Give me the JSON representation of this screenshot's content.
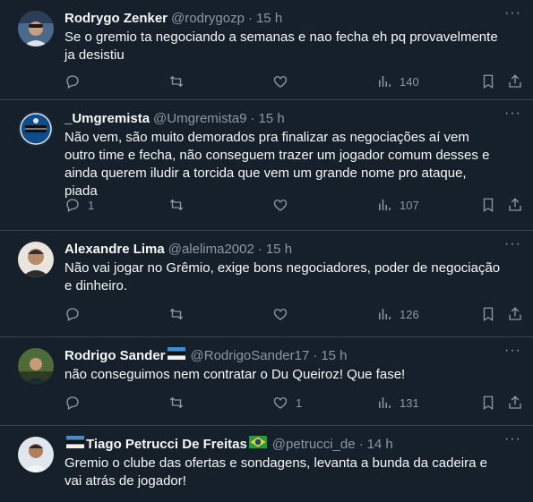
{
  "tweets": [
    {
      "name": "Rodrygo Zenker",
      "handle": "@rodrygozp",
      "time": "15 h",
      "text": "Se o gremio ta negociando a semanas e nao fecha eh pq provavelmente ja desistiu",
      "replies": "",
      "likes": "",
      "views": "140"
    },
    {
      "name": "_Umgremista",
      "handle": "@Umgremista9",
      "time": "15 h",
      "text": "Não vem, são muito demorados pra finalizar as negociações aí vem outro time e fecha, não conseguem trazer um jogador comum desses e ainda querem iludir a torcida que vem um grande nome pro ataque, piada",
      "replies": "1",
      "likes": "",
      "views": "107"
    },
    {
      "name": "Alexandre Lima",
      "handle": "@alelima2002",
      "time": "15 h",
      "text": "Não vai jogar no Grêmio, exige bons negociadores, poder de negociação e dinheiro.",
      "replies": "",
      "likes": "",
      "views": "126"
    },
    {
      "name": "Rodrigo Sander",
      "handle": "@RodrigoSander17",
      "time": "15 h",
      "text": "não conseguimos nem contratar o Du Queiroz! Que fase!",
      "replies": "",
      "likes": "1",
      "views": "131"
    },
    {
      "name": "Tiago Petrucci De Freitas",
      "handle": "@petrucci_de",
      "time": "14 h",
      "text": "Gremio o clube das ofertas e sondagens, levanta a bunda da cadeira e vai atrás de jogador!",
      "replies": "",
      "likes": "",
      "views": ""
    }
  ],
  "separator": "·",
  "more_label": "···",
  "colors": {
    "background": "#15202b",
    "border": "#38444d",
    "muted": "#8b98a5",
    "text": "#f7f9f9"
  }
}
